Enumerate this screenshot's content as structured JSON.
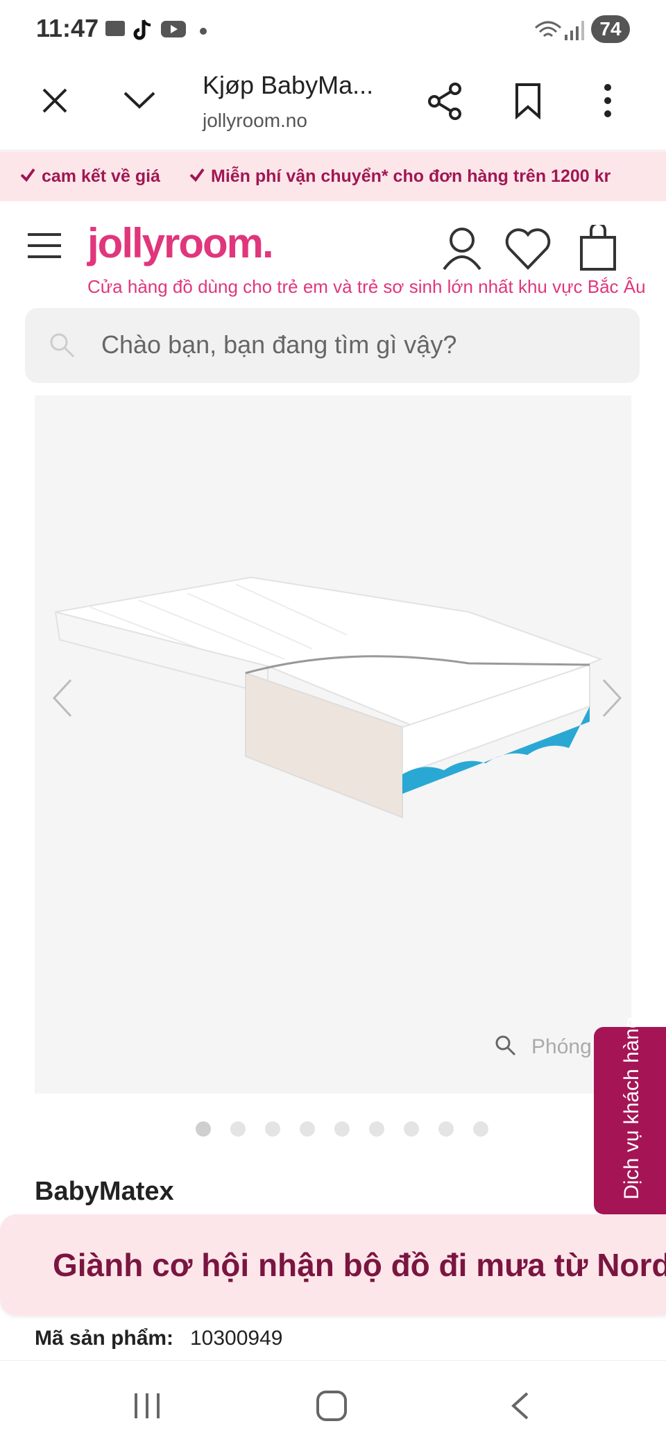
{
  "status_bar": {
    "time": "11:47",
    "battery": "74",
    "icons": [
      "mail-icon",
      "tiktok-icon",
      "youtube-icon",
      "wifi-icon",
      "signal-icon"
    ]
  },
  "browser": {
    "title": "Kjøp BabyMa...",
    "url": "jollyroom.no"
  },
  "promo": {
    "item1": "cam kết về giá",
    "item2": "Miễn phí vận chuyển* cho đơn hàng trên 1200 kr"
  },
  "header": {
    "logo": "jollyroom.",
    "tagline": "Cửa hàng đồ dùng cho trẻ em và trẻ sơ sinh lớn nhất khu vực Bắc Âu"
  },
  "search": {
    "placeholder": "Chào bạn, bạn đang tìm gì vậy?"
  },
  "product": {
    "zoom_label": "Phóng to",
    "image_count": 9,
    "active_image": 1,
    "brand": "BabyMatex",
    "sku_label": "Mã sản phẩm:",
    "sku_value": "10300949"
  },
  "service_tab": {
    "label": "Dịch vụ khách hàng"
  },
  "banner": {
    "text": "Giành cơ hội nhận bộ đồ đi mưa từ Nordic"
  },
  "colors": {
    "brand_pink": "#e0367c",
    "promo_bg": "#fde6ea",
    "service_bg": "#a51556"
  }
}
